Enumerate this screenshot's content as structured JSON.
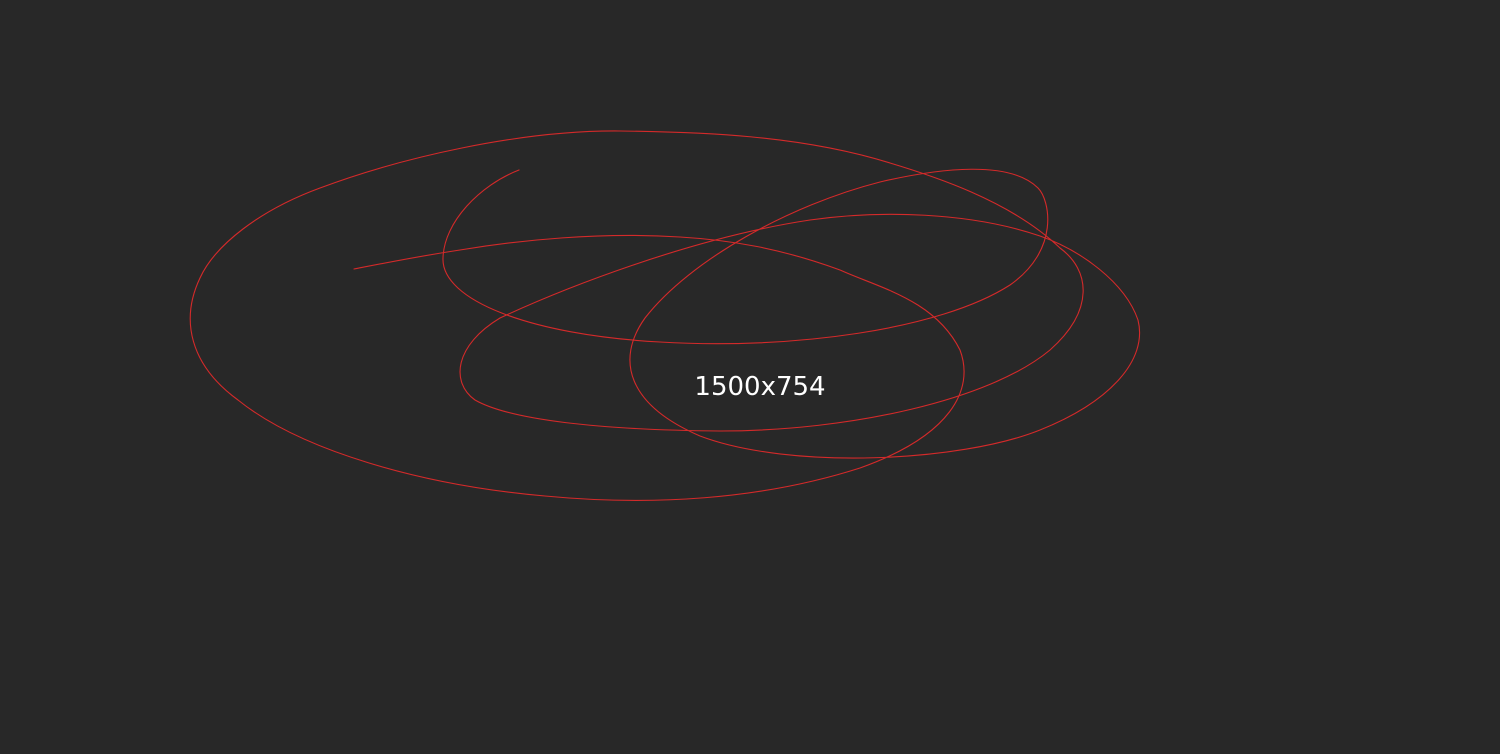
{
  "label": {
    "text": "1500x754"
  },
  "colors": {
    "background": "#282828",
    "stroke": "#d42a2a",
    "text": "#ffffff"
  }
}
